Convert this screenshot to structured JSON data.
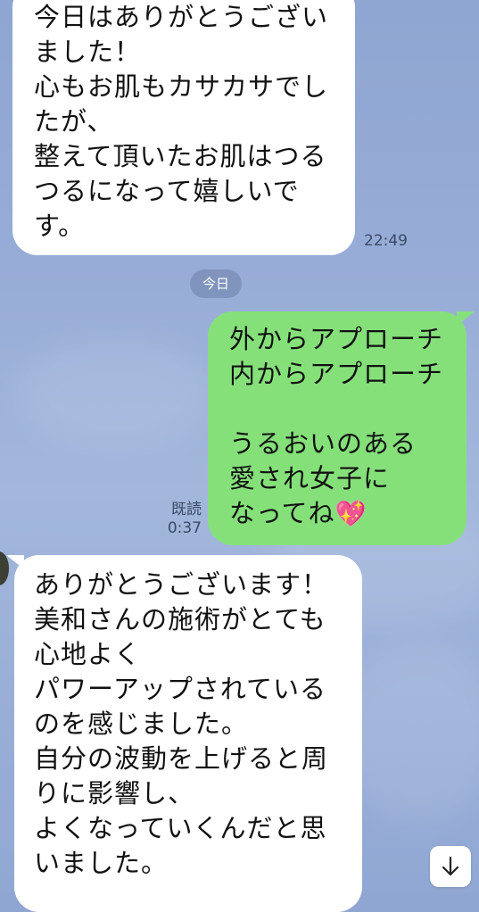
{
  "messages": [
    {
      "lines": [
        "今日はありがとうござい",
        "ました！",
        "心もお肌もカサカサでし",
        "たが、",
        "整えて頂いたお肌はつる",
        "つるになって嬉しいで",
        "す。"
      ],
      "time": "22:49"
    },
    {
      "lines": [
        "外からアプローチ",
        "内からアプローチ",
        "",
        "うるおいのある",
        "愛され女子に",
        "なってね"
      ],
      "emoji": "💖",
      "read": "既読",
      "time": "0:37"
    },
    {
      "lines": [
        "ありがとうございます！",
        "美和さんの施術がとても",
        "心地よく",
        "パワーアップされている",
        "のを感じました。",
        "自分の波動を上げると周",
        "りに影響し、",
        "よくなっていくんだと思",
        "いました。"
      ]
    }
  ],
  "date_separator": "今日",
  "scroll_button_icon": "arrow-down-icon",
  "colors": {
    "incoming_bubble": "#ffffff",
    "outgoing_bubble": "#85e07a",
    "background": "#97acd6"
  }
}
